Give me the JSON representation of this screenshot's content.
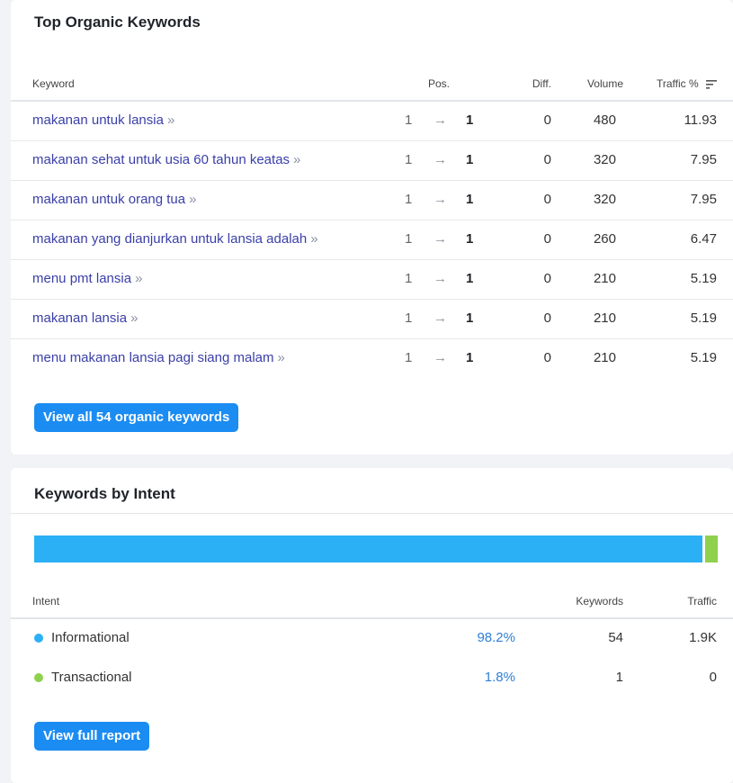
{
  "organic": {
    "title": "Top Organic Keywords",
    "columns": {
      "keyword": "Keyword",
      "pos": "Pos.",
      "diff": "Diff.",
      "volume": "Volume",
      "traffic": "Traffic %"
    },
    "rows": [
      {
        "keyword": "makanan untuk lansia",
        "pos_from": "1",
        "pos_to": "1",
        "diff": "0",
        "volume": "480",
        "traffic": "11.93"
      },
      {
        "keyword": "makanan sehat untuk usia 60 tahun keatas",
        "pos_from": "1",
        "pos_to": "1",
        "diff": "0",
        "volume": "320",
        "traffic": "7.95"
      },
      {
        "keyword": "makanan untuk orang tua",
        "pos_from": "1",
        "pos_to": "1",
        "diff": "0",
        "volume": "320",
        "traffic": "7.95"
      },
      {
        "keyword": "makanan yang dianjurkan untuk lansia adalah",
        "pos_from": "1",
        "pos_to": "1",
        "diff": "0",
        "volume": "260",
        "traffic": "6.47"
      },
      {
        "keyword": "menu pmt lansia",
        "pos_from": "1",
        "pos_to": "1",
        "diff": "0",
        "volume": "210",
        "traffic": "5.19"
      },
      {
        "keyword": "makanan lansia",
        "pos_from": "1",
        "pos_to": "1",
        "diff": "0",
        "volume": "210",
        "traffic": "5.19"
      },
      {
        "keyword": "menu makanan lansia pagi siang malam",
        "pos_from": "1",
        "pos_to": "1",
        "diff": "0",
        "volume": "210",
        "traffic": "5.19"
      }
    ],
    "chevron": "»",
    "arrow": "→",
    "view_all_label": "View all 54 organic keywords"
  },
  "intent": {
    "title": "Keywords by Intent",
    "columns": {
      "intent": "Intent",
      "keywords": "Keywords",
      "traffic": "Traffic"
    },
    "rows": [
      {
        "name": "Informational",
        "percent": "98.2%",
        "share": 0.982,
        "keywords": "54",
        "traffic": "1.9K",
        "color": "#2bb0f5"
      },
      {
        "name": "Transactional",
        "percent": "1.8%",
        "share": 0.018,
        "keywords": "1",
        "traffic": "0",
        "color": "#8fd14f"
      }
    ],
    "view_full_label": "View full report"
  },
  "colors": {
    "accent": "#1b8cf2",
    "link": "#3a3fa8",
    "informational": "#2bb0f5",
    "transactional": "#8fd14f"
  }
}
